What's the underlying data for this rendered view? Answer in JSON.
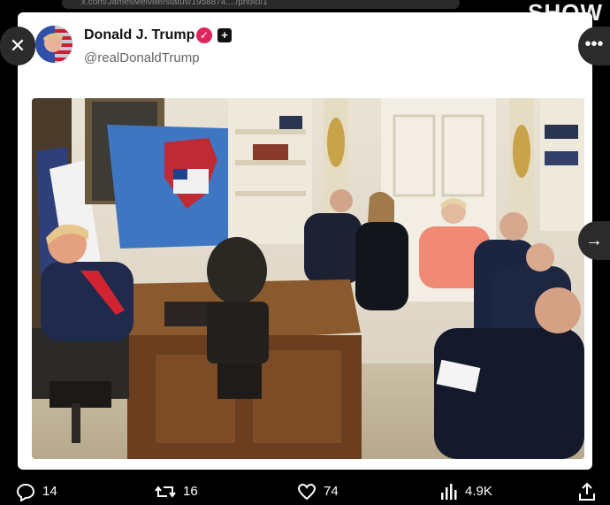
{
  "browser": {
    "url": "x.com/JamesMelville/status/1958874..../photo/1",
    "watermark": "SHOW"
  },
  "post": {
    "display_name": "Donald J. Trump",
    "handle": "@realDonaldTrump",
    "verified_icon": "verified-badge-icon",
    "affiliation_icon": "affiliation-plus-icon"
  },
  "controls": {
    "close_icon": "close-icon",
    "more_icon": "more-icon",
    "next_icon": "arrow-right-icon"
  },
  "actions": {
    "replies": "14",
    "reposts": "16",
    "likes": "74",
    "views": "4.9K"
  },
  "colors": {
    "verified": "#e0245e",
    "background": "#000000",
    "card": "#ffffff"
  }
}
